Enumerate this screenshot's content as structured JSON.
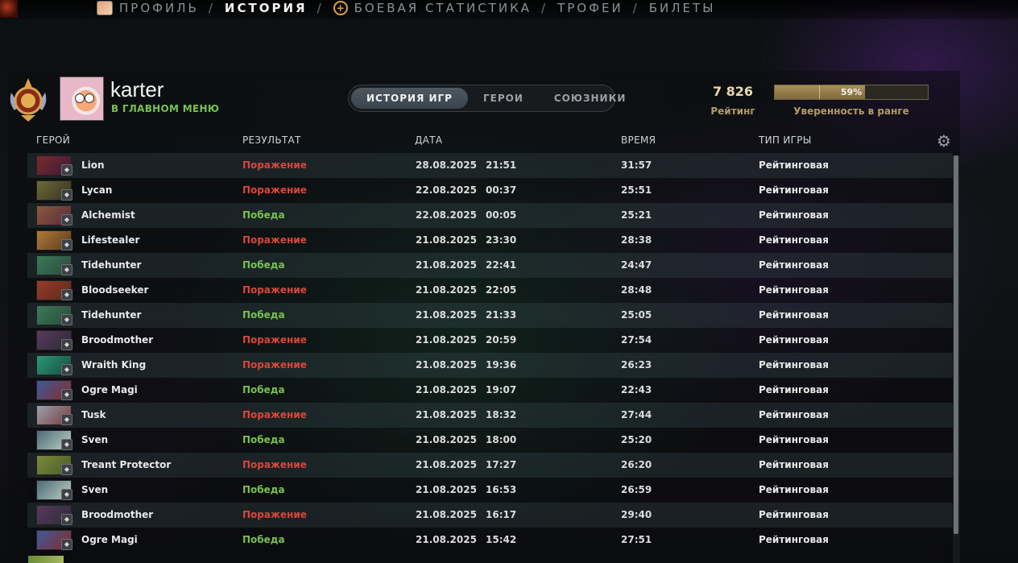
{
  "topnav": {
    "items": [
      {
        "label": "ПРОФИЛЬ",
        "active": false,
        "icon": "profile-avatar-icon"
      },
      {
        "label": "ИСТОРИЯ",
        "active": true
      },
      {
        "label": "БОЕВАЯ СТАТИСТИКА",
        "active": false,
        "icon": "battle-plus-icon"
      },
      {
        "label": "ТРОФЕИ",
        "active": false
      },
      {
        "label": "БИЛЕТЫ",
        "active": false
      }
    ],
    "separator": "/"
  },
  "profile": {
    "username": "karter",
    "status": "В ГЛАВНОМ МЕНЮ",
    "rank_icon": "rank-medal-icon"
  },
  "tabs": [
    {
      "label": "ИСТОРИЯ ИГР",
      "active": true
    },
    {
      "label": "ГЕРОИ",
      "active": false
    },
    {
      "label": "СОЮЗНИКИ",
      "active": false
    }
  ],
  "rating": {
    "value": "7 826",
    "label": "Рейтинг",
    "confidence_percent": 59,
    "confidence_text": "59%",
    "confidence_label": "Уверенность в ранге"
  },
  "columns": {
    "hero": "ГЕРОЙ",
    "result": "РЕЗУЛЬТАТ",
    "date": "ДАТА",
    "duration": "ВРЕМЯ",
    "game_type": "ТИП ИГРЫ"
  },
  "colors": {
    "win": "#78c14f",
    "loss": "#d9463a",
    "accent_gold": "#b39a66"
  },
  "matches": [
    {
      "hero": "Lion",
      "result": "Поражение",
      "win": false,
      "date": "28.08.2025",
      "time": "21:51",
      "duration": "31:57",
      "type": "Рейтинговая",
      "c1": "#7a2a2a",
      "c2": "#3a1a3a"
    },
    {
      "hero": "Lycan",
      "result": "Поражение",
      "win": false,
      "date": "22.08.2025",
      "time": "00:37",
      "duration": "25:51",
      "type": "Рейтинговая",
      "c1": "#6a6a3a",
      "c2": "#3a3020"
    },
    {
      "hero": "Alchemist",
      "result": "Победа",
      "win": true,
      "date": "22.08.2025",
      "time": "00:05",
      "duration": "25:21",
      "type": "Рейтинговая",
      "c1": "#8a5a3a",
      "c2": "#5a2a40"
    },
    {
      "hero": "Lifestealer",
      "result": "Поражение",
      "win": false,
      "date": "21.08.2025",
      "time": "23:30",
      "duration": "28:38",
      "type": "Рейтинговая",
      "c1": "#b07a3a",
      "c2": "#5a3a1a"
    },
    {
      "hero": "Tidehunter",
      "result": "Победа",
      "win": true,
      "date": "21.08.2025",
      "time": "22:41",
      "duration": "24:47",
      "type": "Рейтинговая",
      "c1": "#3a7a5a",
      "c2": "#2a4a3a"
    },
    {
      "hero": "Bloodseeker",
      "result": "Поражение",
      "win": false,
      "date": "21.08.2025",
      "time": "22:05",
      "duration": "28:48",
      "type": "Рейтинговая",
      "c1": "#9a3a2a",
      "c2": "#5a2a1a"
    },
    {
      "hero": "Tidehunter",
      "result": "Победа",
      "win": true,
      "date": "21.08.2025",
      "time": "21:33",
      "duration": "25:05",
      "type": "Рейтинговая",
      "c1": "#3a7a5a",
      "c2": "#2a4a3a"
    },
    {
      "hero": "Broodmother",
      "result": "Поражение",
      "win": false,
      "date": "21.08.2025",
      "time": "20:59",
      "duration": "27:54",
      "type": "Рейтинговая",
      "c1": "#5a3a5a",
      "c2": "#2a2a3a"
    },
    {
      "hero": "Wraith King",
      "result": "Поражение",
      "win": false,
      "date": "21.08.2025",
      "time": "19:36",
      "duration": "26:23",
      "type": "Рейтинговая",
      "c1": "#2a9a7a",
      "c2": "#1a4a3a"
    },
    {
      "hero": "Ogre Magi",
      "result": "Победа",
      "win": true,
      "date": "21.08.2025",
      "time": "19:07",
      "duration": "22:43",
      "type": "Рейтинговая",
      "c1": "#3a5a9a",
      "c2": "#8a2a2a"
    },
    {
      "hero": "Tusk",
      "result": "Поражение",
      "win": false,
      "date": "21.08.2025",
      "time": "18:32",
      "duration": "27:44",
      "type": "Рейтинговая",
      "c1": "#9aa0b0",
      "c2": "#7a3a3a"
    },
    {
      "hero": "Sven",
      "result": "Победа",
      "win": true,
      "date": "21.08.2025",
      "time": "18:00",
      "duration": "25:20",
      "type": "Рейтинговая",
      "c1": "#4a6a7a",
      "c2": "#c0d0c0"
    },
    {
      "hero": "Treant Protector",
      "result": "Поражение",
      "win": false,
      "date": "21.08.2025",
      "time": "17:27",
      "duration": "26:20",
      "type": "Рейтинговая",
      "c1": "#7a8a3a",
      "c2": "#4a5a2a"
    },
    {
      "hero": "Sven",
      "result": "Победа",
      "win": true,
      "date": "21.08.2025",
      "time": "16:53",
      "duration": "26:59",
      "type": "Рейтинговая",
      "c1": "#4a6a7a",
      "c2": "#c0d0c0"
    },
    {
      "hero": "Broodmother",
      "result": "Поражение",
      "win": false,
      "date": "21.08.2025",
      "time": "16:17",
      "duration": "29:40",
      "type": "Рейтинговая",
      "c1": "#5a3a5a",
      "c2": "#2a2a3a"
    },
    {
      "hero": "Ogre Magi",
      "result": "Победа",
      "win": true,
      "date": "21.08.2025",
      "time": "15:42",
      "duration": "27:51",
      "type": "Рейтинговая",
      "c1": "#3a5a9a",
      "c2": "#8a2a2a"
    }
  ]
}
